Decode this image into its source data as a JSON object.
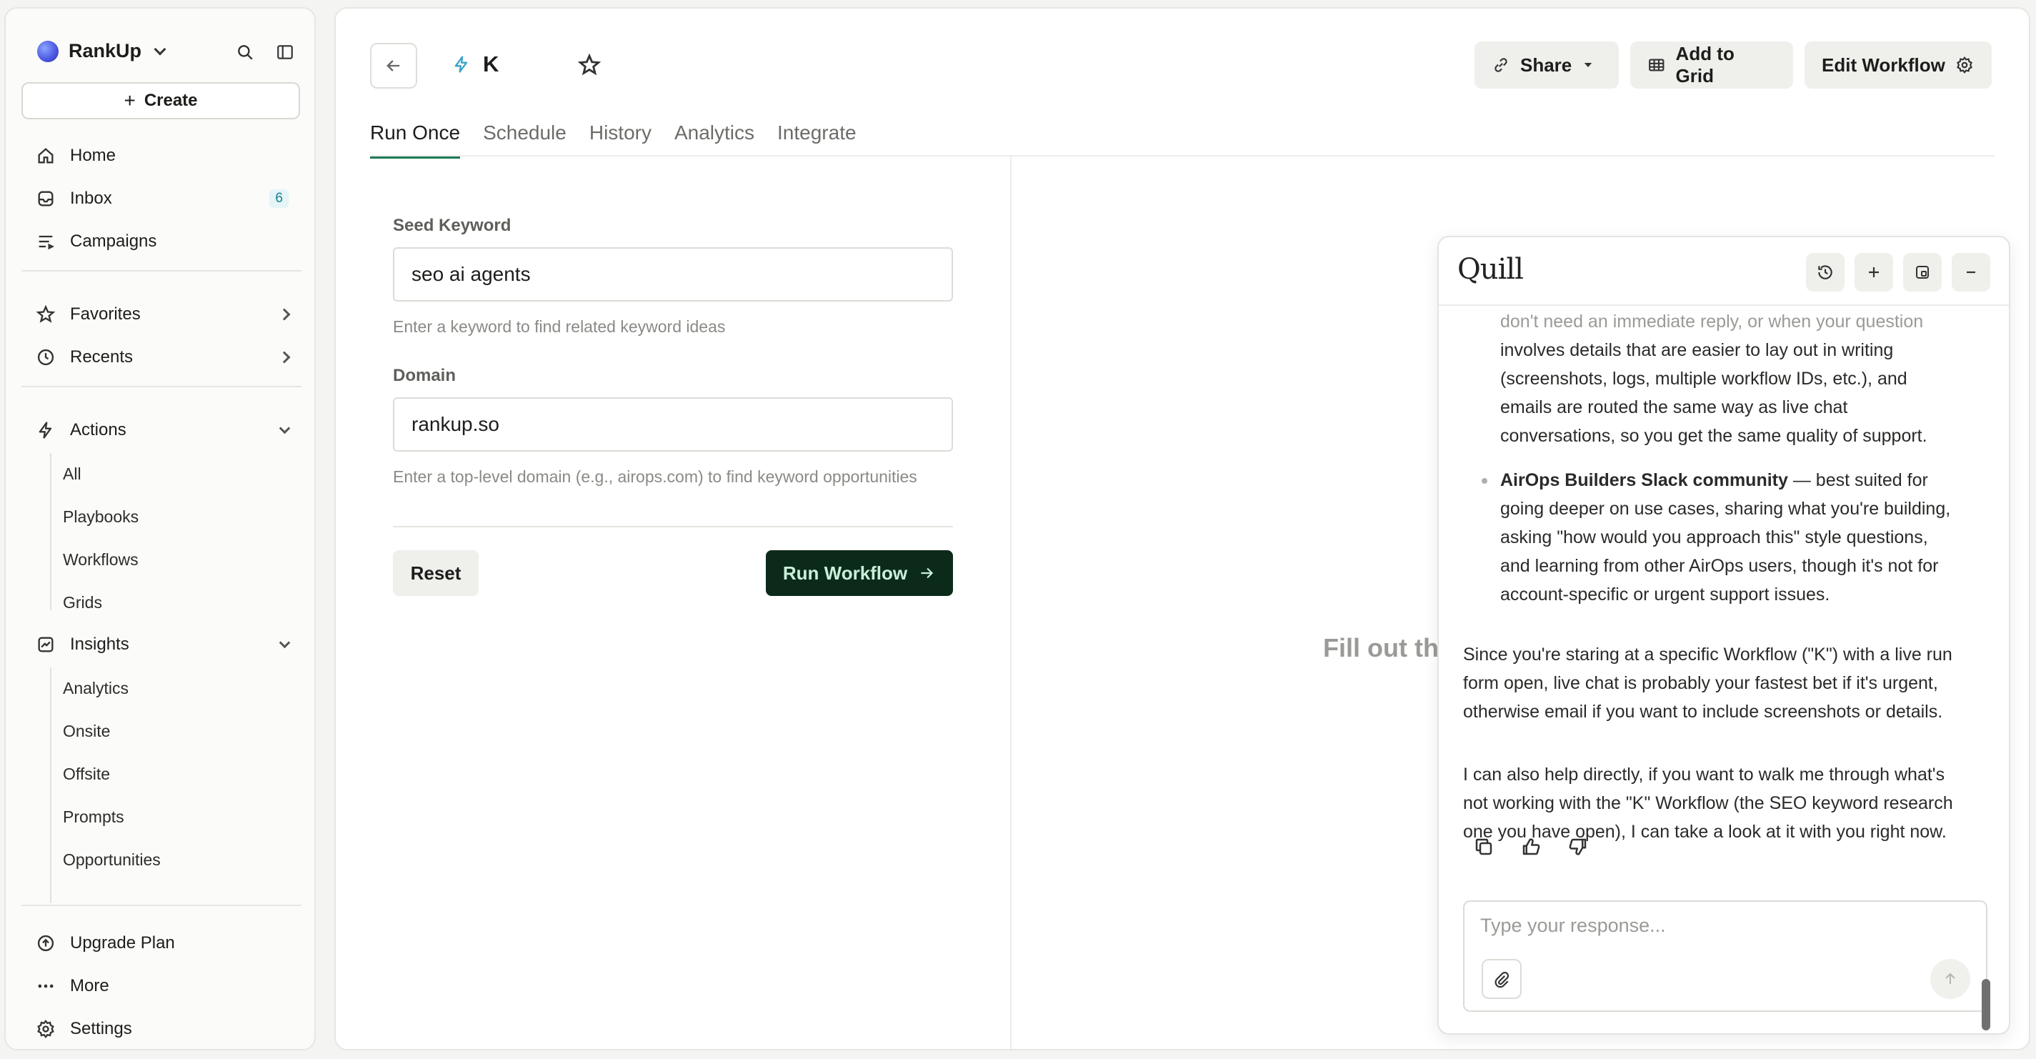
{
  "sidebar": {
    "brand": "RankUp",
    "create_label": "Create",
    "nav": {
      "home": "Home",
      "inbox": "Inbox",
      "inbox_count": "6",
      "campaigns": "Campaigns",
      "favorites": "Favorites",
      "recents": "Recents",
      "actions": "Actions",
      "insights": "Insights",
      "upgrade": "Upgrade Plan",
      "more": "More",
      "settings": "Settings"
    },
    "actions_items": [
      "All",
      "Playbooks",
      "Workflows",
      "Grids"
    ],
    "insights_items": [
      "Analytics",
      "Onsite",
      "Offsite",
      "Prompts",
      "Opportunities"
    ]
  },
  "header": {
    "workflow_title": "K",
    "share_label": "Share",
    "add_to_grid_label": "Add to Grid",
    "edit_workflow_label": "Edit Workflow"
  },
  "tabs": [
    "Run Once",
    "Schedule",
    "History",
    "Analytics",
    "Integrate"
  ],
  "form": {
    "seed_keyword": {
      "label": "Seed Keyword",
      "value": "seo ai agents",
      "help": "Enter a keyword to find related keyword ideas"
    },
    "domain": {
      "label": "Domain",
      "value": "rankup.so",
      "help": "Enter a top-level domain (e.g., airops.com) to find keyword opportunities"
    },
    "reset_label": "Reset",
    "run_label": "Run Workflow"
  },
  "output_placeholder": "Fill out th",
  "chat": {
    "logo": "Quill",
    "bullet1": {
      "faded_line": "don't need an immediate reply, or when your question",
      "rest_lines": [
        "involves details that are easier to lay out in writing",
        "(screenshots, logs, multiple workflow IDs, etc.), and",
        "emails are routed the same way as live chat",
        "conversations, so you get the same quality of support."
      ]
    },
    "bullet2": {
      "bold": "AirOps Builders Slack community",
      "first_rest": " — best suited for",
      "rest_lines": [
        "going deeper on use cases, sharing what you're building,",
        "asking \"how would you approach this\" style questions,",
        "and learning from other AirOps users, though it's not for",
        "account-specific or urgent support issues."
      ]
    },
    "para1_lines": [
      "Since you're staring at a specific Workflow (\"K\") with a live run",
      "form open, live chat is probably your fastest bet if it's urgent,",
      "otherwise email if you want to include screenshots or details."
    ],
    "para2_lines": [
      "I can also help directly, if you want to walk me through what's",
      "not working with the \"K\" Workflow (the SEO keyword research",
      "one you have open), I can take a look at it with you right now."
    ],
    "input_placeholder": "Type your response..."
  }
}
